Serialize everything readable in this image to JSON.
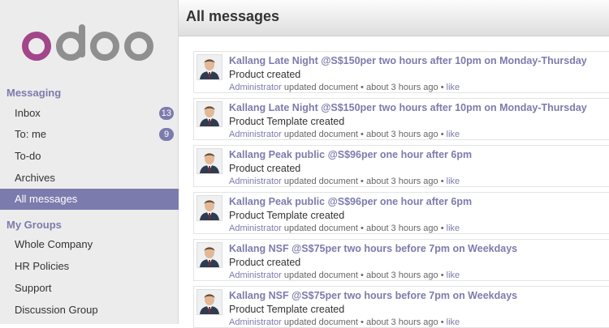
{
  "brand": {
    "logo_text": "odoo"
  },
  "sidebar": {
    "messaging_title": "Messaging",
    "messaging_items": [
      {
        "label": "Inbox",
        "badge": "13"
      },
      {
        "label": "To: me",
        "badge": "9"
      },
      {
        "label": "To-do"
      },
      {
        "label": "Archives"
      },
      {
        "label": "All messages",
        "active": true
      }
    ],
    "groups_title": "My Groups",
    "group_items": [
      {
        "label": "Whole Company"
      },
      {
        "label": "HR Policies"
      },
      {
        "label": "Support"
      },
      {
        "label": "Discussion Group"
      }
    ]
  },
  "main": {
    "title": "All messages",
    "messages": [
      {
        "title": "Kallang Late Night @S$150per two hours after 10pm on Monday-Thursday",
        "body": "Product created",
        "author": "Administrator",
        "action": "updated document",
        "time": "about 3 hours ago",
        "like": "like"
      },
      {
        "title": "Kallang Late Night @S$150per two hours after 10pm on Monday-Thursday",
        "body": "Product Template created",
        "author": "Administrator",
        "action": "updated document",
        "time": "about 3 hours ago",
        "like": "like"
      },
      {
        "title": "Kallang Peak public @S$96per one hour after 6pm",
        "body": "Product created",
        "author": "Administrator",
        "action": "updated document",
        "time": "about 3 hours ago",
        "like": "like"
      },
      {
        "title": "Kallang Peak public @S$96per one hour after 6pm",
        "body": "Product Template created",
        "author": "Administrator",
        "action": "updated document",
        "time": "about 3 hours ago",
        "like": "like"
      },
      {
        "title": "Kallang NSF @S$75per two hours before 7pm on Weekdays",
        "body": "Product created",
        "author": "Administrator",
        "action": "updated document",
        "time": "about 3 hours ago",
        "like": "like"
      },
      {
        "title": "Kallang NSF @S$75per two hours before 7pm on Weekdays",
        "body": "Product Template created",
        "author": "Administrator",
        "action": "updated document",
        "time": "about 3 hours ago",
        "like": "like"
      }
    ]
  },
  "colors": {
    "accent": "#7c7bad",
    "logo_o": "#a24689",
    "logo_gray": "#8f8f8f"
  }
}
